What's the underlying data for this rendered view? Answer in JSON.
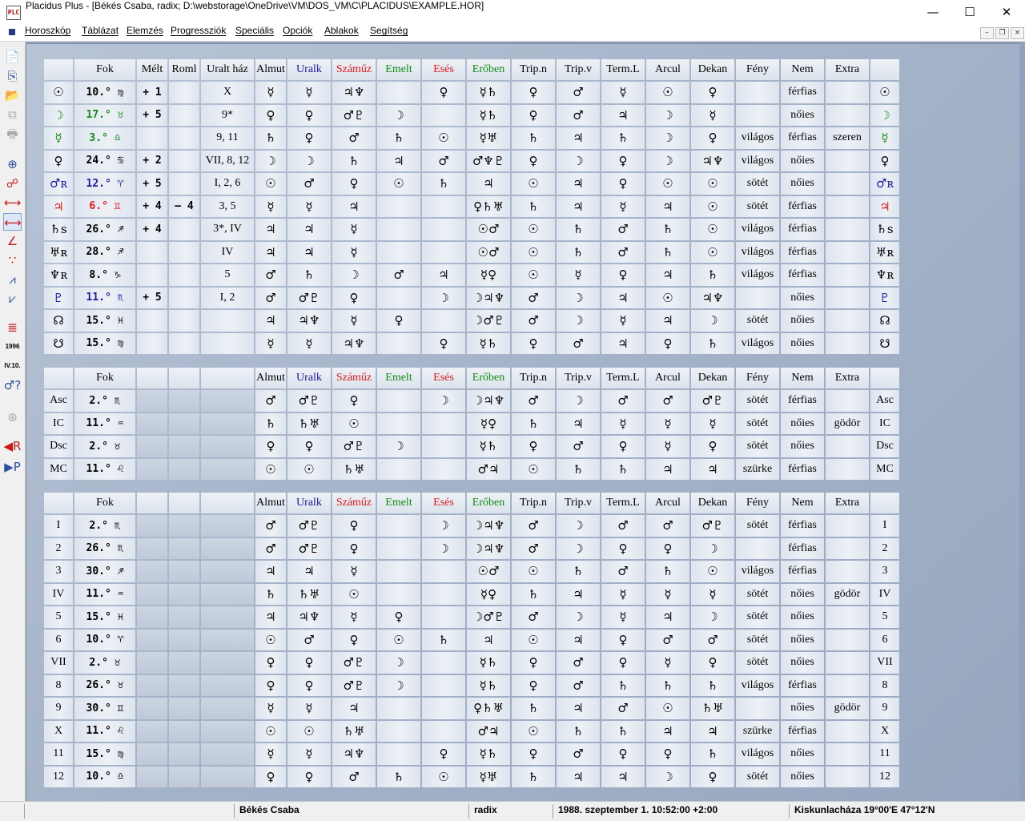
{
  "window": {
    "title": "Placidus Plus - [Békés Csaba,  radix;   D:\\webstorage\\OneDrive\\VM\\DOS_VM\\C\\PLACIDUS\\EXAMPLE.HOR]",
    "icon_text": "PLC",
    "controls": {
      "minimize": "—",
      "maximize": "☐",
      "close": "✕"
    }
  },
  "menu": {
    "items": [
      "Horoszkóp",
      "Táblázat",
      "Elemzés",
      "Progressziók",
      "Speciális",
      "Opciók",
      "Ablakok",
      "Segítség"
    ],
    "mdi": {
      "minimize": "–",
      "restore": "❐",
      "close": "×"
    }
  },
  "toolbar": [
    {
      "icon": "document-icon",
      "glyph": "📄",
      "color": "blue"
    },
    {
      "icon": "new-chart-icon",
      "glyph": "⎘",
      "color": "blue"
    },
    {
      "icon": "open-chart-icon",
      "glyph": "📂",
      "color": "blue"
    },
    {
      "icon": "copy-icon",
      "glyph": "⧉",
      "color": "gray"
    },
    {
      "icon": "print-icon",
      "glyph": "🖶",
      "color": "gray"
    },
    {
      "icon": "wheel-icon",
      "glyph": "⊕",
      "color": "blue"
    },
    {
      "icon": "aspect-circle-icon",
      "glyph": "☍",
      "color": "red"
    },
    {
      "icon": "aspect-line-icon",
      "glyph": "⟷",
      "color": "red"
    },
    {
      "icon": "table-icon",
      "glyph": "⟷",
      "color": "red",
      "active": true
    },
    {
      "icon": "triangle-aspect-icon",
      "glyph": "∠",
      "color": "red"
    },
    {
      "icon": "dots-icon",
      "glyph": "∵",
      "color": "red"
    },
    {
      "icon": "line-red-icon",
      "glyph": "⩘",
      "color": "blue"
    },
    {
      "icon": "line-blue-icon",
      "glyph": "⩗",
      "color": "blue"
    },
    {
      "icon": "list-icon",
      "glyph": "≣",
      "color": "red"
    },
    {
      "icon": "year-icon",
      "glyph": "1996",
      "color": "small"
    },
    {
      "icon": "date-icon",
      "glyph": "IV.10.",
      "color": "small"
    },
    {
      "icon": "planet-question-icon",
      "glyph": "♂?",
      "color": "blue"
    },
    {
      "icon": "wheel-gray-icon",
      "glyph": "⊛",
      "color": "gray"
    },
    {
      "icon": "radix-icon",
      "glyph": "◀R",
      "color": "red"
    },
    {
      "icon": "progression-icon",
      "glyph": "▶P",
      "color": "blue"
    }
  ],
  "colors": {
    "almut": "#000000",
    "uralk": "#1a1aa0",
    "szamuz": "#e01818",
    "emelt": "#108a10",
    "eses": "#e01818",
    "erobe": "#108a10"
  },
  "planets": {
    "headers": [
      "",
      "Fok",
      "Mélt",
      "Roml",
      "Uralt ház",
      "Almut",
      "Uralk",
      "Száműz",
      "Emelt",
      "Esés",
      "Erőben",
      "Trip.n",
      "Trip.v",
      "Term.L",
      "Arcul",
      "Dekan",
      "Fény",
      "Nem",
      "Extra",
      ""
    ],
    "rows": [
      [
        "☉",
        "10.° ♍",
        "+ 1",
        "",
        "X",
        "☿",
        "☿",
        "♃♆",
        "",
        "♀",
        "☿♄",
        "♀",
        "♂",
        "☿",
        "☉",
        "♀",
        "",
        "férfias",
        "",
        "☉"
      ],
      [
        "☽",
        "17.° ♉",
        "+ 5",
        "",
        "9*",
        "♀",
        "♀",
        "♂♇",
        "☽",
        "",
        "☿♄",
        "♀",
        "♂",
        "♃",
        "☽",
        "☿",
        "",
        "nőies",
        "",
        "☽"
      ],
      [
        "☿",
        "3.° ♎",
        "",
        "",
        "9, 11",
        "♄",
        "♀",
        "♂",
        "♄",
        "☉",
        "☿♅",
        "♄",
        "♃",
        "♄",
        "☽",
        "♀",
        "világos",
        "férfias",
        "szeren",
        "☿"
      ],
      [
        "♀",
        "24.° ♋",
        "+ 2",
        "",
        "VII, 8, 12",
        "☽",
        "☽",
        "♄",
        "♃",
        "♂",
        "♂♆♇",
        "♀",
        "☽",
        "♀",
        "☽",
        "♃♆",
        "világos",
        "nőies",
        "",
        "♀"
      ],
      [
        "♂ʀ",
        "12.° ♈",
        "+ 5",
        "",
        "I, 2, 6",
        "☉",
        "♂",
        "♀",
        "☉",
        "♄",
        "♃",
        "☉",
        "♃",
        "♀",
        "☉",
        "☉",
        "sötét",
        "nőies",
        "",
        "♂ʀ"
      ],
      [
        "♃",
        "6.° ♊",
        "+ 4",
        "– 4",
        "3, 5",
        "☿",
        "☿",
        "♃",
        "",
        "",
        "♀♄♅",
        "♄",
        "♃",
        "☿",
        "♃",
        "☉",
        "sötét",
        "férfias",
        "",
        "♃"
      ],
      [
        "♄s",
        "26.° ♐",
        "+ 4",
        "",
        "3*, IV",
        "♃",
        "♃",
        "☿",
        "",
        "",
        "☉♂",
        "☉",
        "♄",
        "♂",
        "♄",
        "☉",
        "világos",
        "férfias",
        "",
        "♄s"
      ],
      [
        "♅ʀ",
        "28.° ♐",
        "",
        "",
        "IV",
        "♃",
        "♃",
        "☿",
        "",
        "",
        "☉♂",
        "☉",
        "♄",
        "♂",
        "♄",
        "☉",
        "világos",
        "férfias",
        "",
        "♅ʀ"
      ],
      [
        "♆ʀ",
        "8.° ♑",
        "",
        "",
        "5",
        "♂",
        "♄",
        "☽",
        "♂",
        "♃",
        "☿♀",
        "☉",
        "☿",
        "♀",
        "♃",
        "♄",
        "világos",
        "férfias",
        "",
        "♆ʀ"
      ],
      [
        "♇",
        "11.° ♏",
        "+ 5",
        "",
        "I, 2",
        "♂",
        "♂♇",
        "♀",
        "",
        "☽",
        "☽♃♆",
        "♂",
        "☽",
        "♃",
        "☉",
        "♃♆",
        "",
        "nőies",
        "",
        "♇"
      ],
      [
        "☊",
        "15.° ♓",
        "",
        "",
        "",
        "♃",
        "♃♆",
        "☿",
        "♀",
        "",
        "☽♂♇",
        "♂",
        "☽",
        "☿",
        "♃",
        "☽",
        "sötét",
        "nőies",
        "",
        "☊"
      ],
      [
        "☋",
        "15.° ♍",
        "",
        "",
        "",
        "☿",
        "☿",
        "♃♆",
        "",
        "♀",
        "☿♄",
        "♀",
        "♂",
        "♃",
        "♀",
        "♄",
        "világos",
        "nőies",
        "",
        "☋"
      ]
    ]
  },
  "angles": {
    "headers": [
      "",
      "Fok",
      "",
      "",
      "",
      "Almut",
      "Uralk",
      "Száműz",
      "Emelt",
      "Esés",
      "Erőben",
      "Trip.n",
      "Trip.v",
      "Term.L",
      "Arcul",
      "Dekan",
      "Fény",
      "Nem",
      "Extra",
      ""
    ],
    "rows": [
      [
        "Asc",
        "2.° ♏",
        "",
        "",
        "",
        "♂",
        "♂♇",
        "♀",
        "",
        "☽",
        "☽♃♆",
        "♂",
        "☽",
        "♂",
        "♂",
        "♂♇",
        "sötét",
        "férfias",
        "",
        "Asc"
      ],
      [
        "IC",
        "11.° ♒",
        "",
        "",
        "",
        "♄",
        "♄♅",
        "☉",
        "",
        "",
        "☿♀",
        "♄",
        "♃",
        "☿",
        "☿",
        "☿",
        "sötét",
        "nőies",
        "gödör",
        "IC"
      ],
      [
        "Dsc",
        "2.° ♉",
        "",
        "",
        "",
        "♀",
        "♀",
        "♂♇",
        "☽",
        "",
        "☿♄",
        "♀",
        "♂",
        "♀",
        "☿",
        "♀",
        "sötét",
        "nőies",
        "",
        "Dsc"
      ],
      [
        "MC",
        "11.° ♌",
        "",
        "",
        "",
        "☉",
        "☉",
        "♄♅",
        "",
        "",
        "♂♃",
        "☉",
        "♄",
        "♄",
        "♃",
        "♃",
        "szürke",
        "férfias",
        "",
        "MC"
      ]
    ]
  },
  "houses": {
    "headers": [
      "",
      "Fok",
      "",
      "",
      "",
      "Almut",
      "Uralk",
      "Száműz",
      "Emelt",
      "Esés",
      "Erőben",
      "Trip.n",
      "Trip.v",
      "Term.L",
      "Arcul",
      "Dekan",
      "Fény",
      "Nem",
      "Extra",
      ""
    ],
    "rows": [
      [
        "I",
        "2.° ♏",
        "",
        "",
        "",
        "♂",
        "♂♇",
        "♀",
        "",
        "☽",
        "☽♃♆",
        "♂",
        "☽",
        "♂",
        "♂",
        "♂♇",
        "sötét",
        "férfias",
        "",
        "I"
      ],
      [
        "2",
        "26.° ♏",
        "",
        "",
        "",
        "♂",
        "♂♇",
        "♀",
        "",
        "☽",
        "☽♃♆",
        "♂",
        "☽",
        "♀",
        "♀",
        "☽",
        "",
        "férfias",
        "",
        "2"
      ],
      [
        "3",
        "30.° ♐",
        "",
        "",
        "",
        "♃",
        "♃",
        "☿",
        "",
        "",
        "☉♂",
        "☉",
        "♄",
        "♂",
        "♄",
        "☉",
        "világos",
        "férfias",
        "",
        "3"
      ],
      [
        "IV",
        "11.° ♒",
        "",
        "",
        "",
        "♄",
        "♄♅",
        "☉",
        "",
        "",
        "☿♀",
        "♄",
        "♃",
        "☿",
        "☿",
        "☿",
        "sötét",
        "nőies",
        "gödör",
        "IV"
      ],
      [
        "5",
        "15.° ♓",
        "",
        "",
        "",
        "♃",
        "♃♆",
        "☿",
        "♀",
        "",
        "☽♂♇",
        "♂",
        "☽",
        "☿",
        "♃",
        "☽",
        "sötét",
        "nőies",
        "",
        "5"
      ],
      [
        "6",
        "10.° ♈",
        "",
        "",
        "",
        "☉",
        "♂",
        "♀",
        "☉",
        "♄",
        "♃",
        "☉",
        "♃",
        "♀",
        "♂",
        "♂",
        "sötét",
        "nőies",
        "",
        "6"
      ],
      [
        "VII",
        "2.° ♉",
        "",
        "",
        "",
        "♀",
        "♀",
        "♂♇",
        "☽",
        "",
        "☿♄",
        "♀",
        "♂",
        "♀",
        "☿",
        "♀",
        "sötét",
        "nőies",
        "",
        "VII"
      ],
      [
        "8",
        "26.° ♉",
        "",
        "",
        "",
        "♀",
        "♀",
        "♂♇",
        "☽",
        "",
        "☿♄",
        "♀",
        "♂",
        "♄",
        "♄",
        "♄",
        "világos",
        "férfias",
        "",
        "8"
      ],
      [
        "9",
        "30.° ♊",
        "",
        "",
        "",
        "☿",
        "☿",
        "♃",
        "",
        "",
        "♀♄♅",
        "♄",
        "♃",
        "♂",
        "☉",
        "♄♅",
        "",
        "nőies",
        "gödör",
        "9"
      ],
      [
        "X",
        "11.° ♌",
        "",
        "",
        "",
        "☉",
        "☉",
        "♄♅",
        "",
        "",
        "♂♃",
        "☉",
        "♄",
        "♄",
        "♃",
        "♃",
        "szürke",
        "férfias",
        "",
        "X"
      ],
      [
        "11",
        "15.° ♍",
        "",
        "",
        "",
        "☿",
        "☿",
        "♃♆",
        "",
        "♀",
        "☿♄",
        "♀",
        "♂",
        "♀",
        "♀",
        "♄",
        "világos",
        "nőies",
        "",
        "11"
      ],
      [
        "12",
        "10.° ♎",
        "",
        "",
        "",
        "♀",
        "♀",
        "♂",
        "♄",
        "☉",
        "☿♅",
        "♄",
        "♃",
        "♃",
        "☽",
        "♀",
        "sötét",
        "nőies",
        "",
        "12"
      ]
    ]
  },
  "status": {
    "name": "Békés Csaba",
    "chart_type": "radix",
    "datetime": "1988. szeptember 1.  10:52:00 +2:00",
    "location": "Kiskunlacháza  19°00'E  47°12'N"
  }
}
